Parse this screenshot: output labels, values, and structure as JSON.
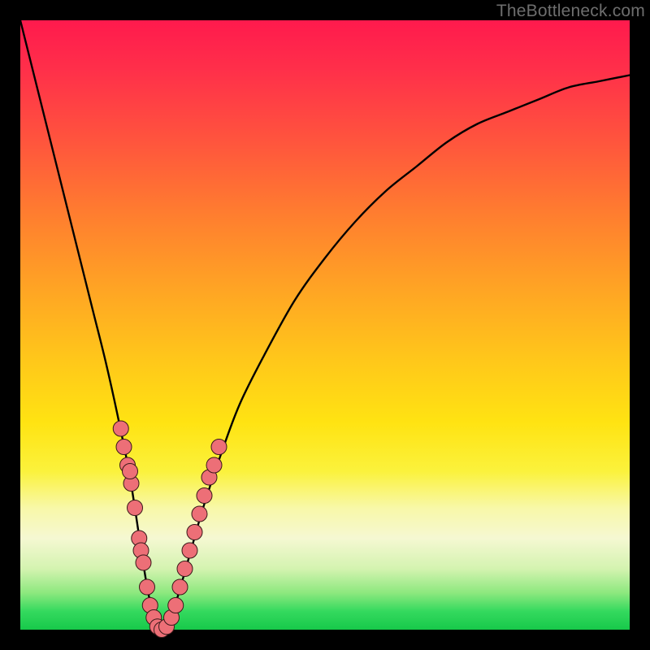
{
  "watermark": "TheBottleneck.com",
  "colors": {
    "frame": "#000000",
    "curve_stroke": "#000000",
    "dot_fill": "#ed6f77",
    "dot_stroke": "#3a1a1a",
    "gradient_top": "#ff1a4d",
    "gradient_bottom": "#17c94a"
  },
  "chart_data": {
    "type": "line",
    "title": "",
    "xlabel": "",
    "ylabel": "",
    "xlim": [
      0,
      100
    ],
    "ylim": [
      0,
      100
    ],
    "grid": false,
    "legend": false,
    "note": "V-shaped bottleneck curve. y≈0 means optimal (no bottleneck). Minimum is near x≈23. Values estimated from pixel positions vs. gradient.",
    "series": [
      {
        "name": "bottleneck-curve",
        "x": [
          0,
          2,
          5,
          8,
          10,
          12,
          14,
          16,
          18,
          20,
          21,
          22,
          23,
          24,
          25,
          26,
          28,
          30,
          33,
          36,
          40,
          45,
          50,
          55,
          60,
          65,
          70,
          75,
          80,
          85,
          90,
          95,
          100
        ],
        "y": [
          100,
          92,
          80,
          68,
          60,
          52,
          44,
          35,
          25,
          12,
          6,
          2,
          0,
          1,
          3,
          6,
          13,
          20,
          29,
          37,
          45,
          54,
          61,
          67,
          72,
          76,
          80,
          83,
          85,
          87,
          89,
          90,
          91
        ]
      }
    ],
    "highlight_points": {
      "name": "sample-dots",
      "note": "Pink beads clustered on both arms near the trough.",
      "points": [
        {
          "x": 16.5,
          "y": 33
        },
        {
          "x": 17.0,
          "y": 30
        },
        {
          "x": 17.6,
          "y": 27
        },
        {
          "x": 18.2,
          "y": 24
        },
        {
          "x": 18.0,
          "y": 26
        },
        {
          "x": 18.8,
          "y": 20
        },
        {
          "x": 19.5,
          "y": 15
        },
        {
          "x": 19.8,
          "y": 13
        },
        {
          "x": 20.2,
          "y": 11
        },
        {
          "x": 20.8,
          "y": 7
        },
        {
          "x": 21.3,
          "y": 4
        },
        {
          "x": 21.9,
          "y": 2
        },
        {
          "x": 22.5,
          "y": 0.5
        },
        {
          "x": 23.2,
          "y": 0
        },
        {
          "x": 24.0,
          "y": 0.5
        },
        {
          "x": 24.8,
          "y": 2
        },
        {
          "x": 25.5,
          "y": 4
        },
        {
          "x": 26.2,
          "y": 7
        },
        {
          "x": 27.0,
          "y": 10
        },
        {
          "x": 27.8,
          "y": 13
        },
        {
          "x": 28.6,
          "y": 16
        },
        {
          "x": 29.4,
          "y": 19
        },
        {
          "x": 30.2,
          "y": 22
        },
        {
          "x": 31.0,
          "y": 25
        },
        {
          "x": 31.8,
          "y": 27
        },
        {
          "x": 32.6,
          "y": 30
        }
      ]
    }
  }
}
